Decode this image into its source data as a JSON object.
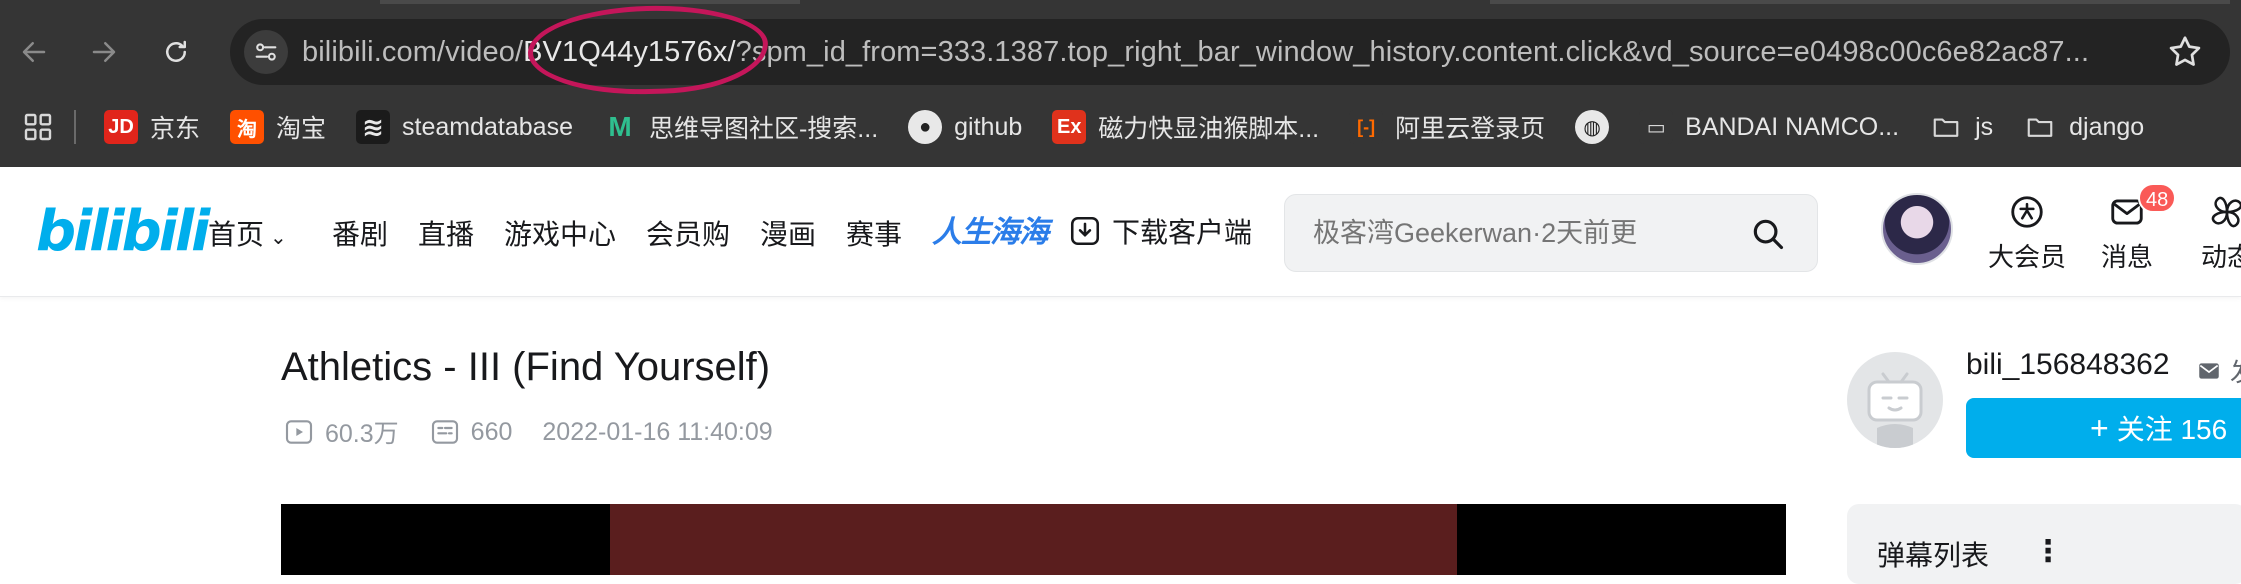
{
  "browser": {
    "url_host": "bilibili.com/video/",
    "url_highlight": "BV1Q44y1576x/",
    "url_rest": "?spm_id_from=333.1387.top_right_bar_window_history.content.click&vd_source=e0498c00c6e82ac87...",
    "bookmarks": [
      {
        "label": "京东",
        "icon": "jd-icon",
        "glyph": "JD",
        "color": "#e1251b"
      },
      {
        "label": "淘宝",
        "icon": "taobao-icon",
        "glyph": "淘",
        "color": "#ff5000"
      },
      {
        "label": "steamdatabase",
        "icon": "steamdb-icon",
        "glyph": "≋",
        "color": "#1b1b1b"
      },
      {
        "label": "思维导图社区-搜索...",
        "icon": "mindmap-icon",
        "glyph": "M",
        "color": "#2fbf8f"
      },
      {
        "label": "github",
        "icon": "github-icon",
        "glyph": "●",
        "color": "#353535"
      },
      {
        "label": "磁力快显油猴脚本...",
        "icon": "ex-icon",
        "glyph": "Ex",
        "color": "#e0321c"
      },
      {
        "label": "阿里云登录页",
        "icon": "aliyun-icon",
        "glyph": "[-]",
        "color": "#353535"
      },
      {
        "label": "",
        "icon": "globe-icon",
        "glyph": "◍",
        "color": "#353535"
      },
      {
        "label": "BANDAI NAMCO...",
        "icon": "bandai-icon",
        "glyph": "▭",
        "color": "#353535"
      },
      {
        "label": "js",
        "icon": "folder-icon",
        "glyph": "",
        "color": "#353535"
      },
      {
        "label": "django",
        "icon": "folder-icon",
        "glyph": "",
        "color": "#353535"
      }
    ]
  },
  "header": {
    "logo": "bilibili",
    "nav": [
      "首页",
      "番剧",
      "直播",
      "游戏中心",
      "会员购",
      "漫画",
      "赛事"
    ],
    "promo": "人生海海",
    "download": "下载客户端",
    "search_placeholder": "极客湾Geekerwan·2天前更",
    "vip_label": "大会员",
    "message_label": "消息",
    "message_badge": "48",
    "dynamic_label": "动态"
  },
  "video": {
    "title": "Athletics - III (Find Yourself)",
    "views": "60.3万",
    "danmaku_count": "660",
    "date": "2022-01-16 11:40:09"
  },
  "uploader": {
    "name": "bili_156848362",
    "message_label": "发",
    "follow_label": "关注 156"
  },
  "danmaku_panel": {
    "title": "弹幕列表"
  },
  "colors": {
    "accent": "#00aeec",
    "highlight_circle": "#c4165a",
    "badge": "#fa5a57"
  }
}
